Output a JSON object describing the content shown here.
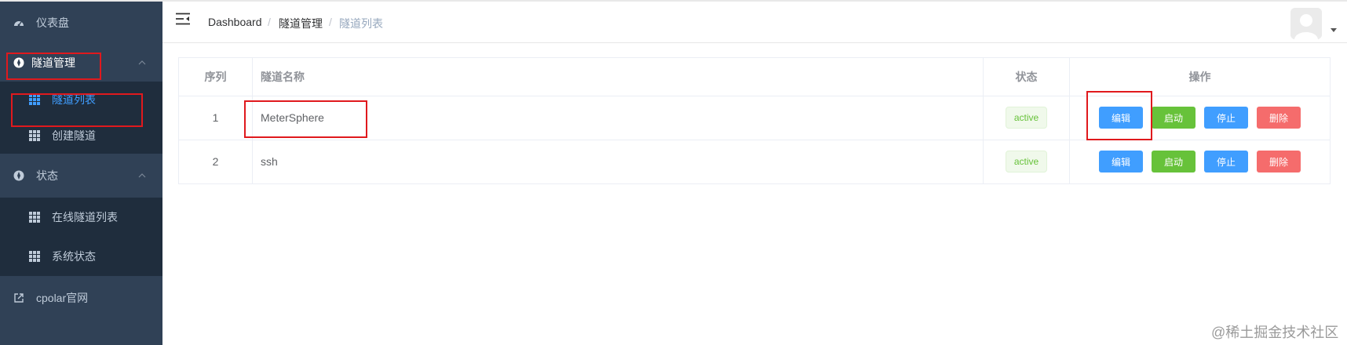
{
  "sidebar": {
    "items": [
      {
        "label": "仪表盘",
        "icon": "dashboard-icon"
      },
      {
        "label": "隧道管理",
        "icon": "compass-icon",
        "expanded": true,
        "children": [
          {
            "label": "隧道列表",
            "icon": "grid-icon",
            "active": true
          },
          {
            "label": "创建隧道",
            "icon": "grid-icon"
          }
        ]
      },
      {
        "label": "状态",
        "icon": "compass-icon",
        "expanded": true,
        "children": [
          {
            "label": "在线隧道列表",
            "icon": "grid-icon"
          },
          {
            "label": "系统状态",
            "icon": "grid-icon"
          }
        ]
      },
      {
        "label": "cpolar官网",
        "icon": "external-link-icon"
      }
    ]
  },
  "header": {
    "breadcrumb": [
      "Dashboard",
      "隧道管理",
      "隧道列表"
    ],
    "separator": "/"
  },
  "table": {
    "columns": [
      "序列",
      "隧道名称",
      "状态",
      "操作"
    ],
    "rows": [
      {
        "index": "1",
        "name": "MeterSphere",
        "status": "active"
      },
      {
        "index": "2",
        "name": "ssh",
        "status": "active"
      }
    ],
    "actions": [
      "编辑",
      "启动",
      "停止",
      "删除"
    ]
  },
  "watermark": "@稀土掘金技术社区",
  "colors": {
    "sidebar_bg": "#304156",
    "submenu_bg": "#1f2d3d",
    "sidebar_text": "#bfcbd9",
    "active_text": "#409eff",
    "primary": "#409eff",
    "success": "#67c23a",
    "danger": "#f56c6c",
    "annotation": "#e0191d"
  }
}
